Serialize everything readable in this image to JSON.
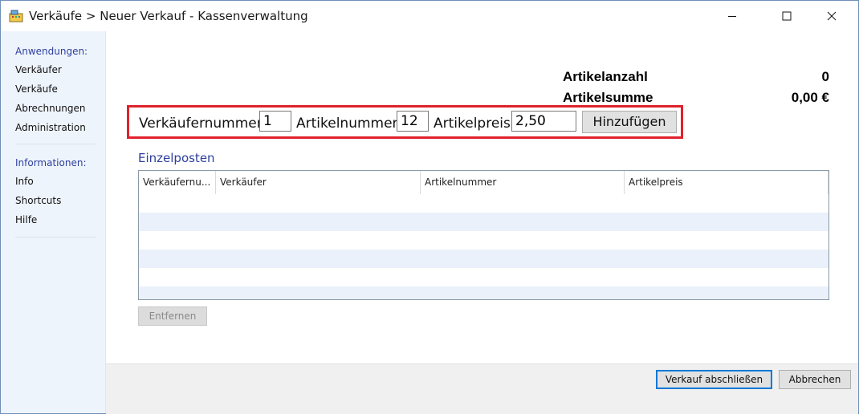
{
  "window": {
    "title": "Verkäufe > Neuer Verkauf - Kassenverwaltung",
    "app_icon": "cash-register-icon",
    "controls": {
      "minimize": "minimize-icon",
      "maximize": "maximize-icon",
      "close": "close-icon"
    }
  },
  "sidebar": {
    "groups": [
      {
        "heading": "Anwendungen:",
        "items": [
          "Verkäufer",
          "Verkäufe",
          "Abrechnungen",
          "Administration"
        ]
      },
      {
        "heading": "Informationen:",
        "items": [
          "Info",
          "Shortcuts",
          "Hilfe"
        ]
      }
    ]
  },
  "summary": {
    "count_label": "Artikelanzahl",
    "count_value": "0",
    "sum_label": "Artikelsumme",
    "sum_value": "0,00 €"
  },
  "entry": {
    "seller_label": "Verkäufernummer:",
    "seller_value": "1",
    "article_label": "Artikelnummer:",
    "article_value": "12",
    "price_label": "Artikelpreis:",
    "price_value": "2,50",
    "add_label": "Hinzufügen",
    "highlight_color": "#e0212b"
  },
  "items": {
    "title": "Einzelposten",
    "columns": [
      "Verkäufernu...",
      "Verkäufer",
      "Artikelnummer",
      "Artikelpreis"
    ],
    "rows": []
  },
  "remove_label": "Entfernen",
  "footer": {
    "finish_label": "Verkauf abschließen",
    "cancel_label": "Abbrechen"
  },
  "colors": {
    "accent": "#2d3f9e",
    "sidebar_bg": "#eef4fc",
    "row_alt": "#eaf1fb"
  }
}
